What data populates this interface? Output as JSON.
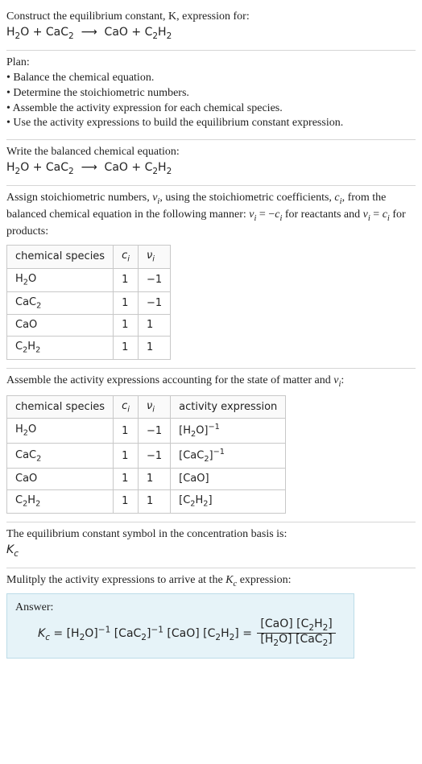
{
  "intro": {
    "line1": "Construct the equilibrium constant, K, expression for:",
    "equation_html": "H<span class='sub'>2</span>O + CaC<span class='sub'>2</span> &nbsp;⟶&nbsp; CaO + C<span class='sub'>2</span>H<span class='sub'>2</span>"
  },
  "plan": {
    "title": "Plan:",
    "b1": "• Balance the chemical equation.",
    "b2": "• Determine the stoichiometric numbers.",
    "b3": "• Assemble the activity expression for each chemical species.",
    "b4": "• Use the activity expressions to build the equilibrium constant expression."
  },
  "balance": {
    "title": "Write the balanced chemical equation:",
    "equation_html": "H<span class='sub'>2</span>O + CaC<span class='sub'>2</span> &nbsp;⟶&nbsp; CaO + C<span class='sub'>2</span>H<span class='sub'>2</span>"
  },
  "stoich": {
    "intro_html": "Assign stoichiometric numbers, <span class='it'>ν<span class='sub'>i</span></span>, using the stoichiometric coefficients, <span class='it'>c<span class='sub'>i</span></span>, from the balanced chemical equation in the following manner: <span class='it'>ν<span class='sub'>i</span></span> = −<span class='it'>c<span class='sub'>i</span></span> for reactants and <span class='it'>ν<span class='sub'>i</span></span> = <span class='it'>c<span class='sub'>i</span></span> for products:",
    "headers": {
      "h1": "chemical species",
      "h2_html": "<span class='it'>c<span class='sub'>i</span></span>",
      "h3_html": "<span class='it'>ν<span class='sub'>i</span></span>"
    },
    "rows": [
      {
        "sp_html": "H<span class='sub'>2</span>O",
        "c": "1",
        "v": "−1"
      },
      {
        "sp_html": "CaC<span class='sub'>2</span>",
        "c": "1",
        "v": "−1"
      },
      {
        "sp_html": "CaO",
        "c": "1",
        "v": "1"
      },
      {
        "sp_html": "C<span class='sub'>2</span>H<span class='sub'>2</span>",
        "c": "1",
        "v": "1"
      }
    ]
  },
  "activity": {
    "intro_html": "Assemble the activity expressions accounting for the state of matter and <span class='it'>ν<span class='sub'>i</span></span>:",
    "headers": {
      "h1": "chemical species",
      "h2_html": "<span class='it'>c<span class='sub'>i</span></span>",
      "h3_html": "<span class='it'>ν<span class='sub'>i</span></span>",
      "h4": "activity expression"
    },
    "rows": [
      {
        "sp_html": "H<span class='sub'>2</span>O",
        "c": "1",
        "v": "−1",
        "act_html": "[H<span class='sub'>2</span>O]<span class='sup'>−1</span>"
      },
      {
        "sp_html": "CaC<span class='sub'>2</span>",
        "c": "1",
        "v": "−1",
        "act_html": "[CaC<span class='sub'>2</span>]<span class='sup'>−1</span>"
      },
      {
        "sp_html": "CaO",
        "c": "1",
        "v": "1",
        "act_html": "[CaO]"
      },
      {
        "sp_html": "C<span class='sub'>2</span>H<span class='sub'>2</span>",
        "c": "1",
        "v": "1",
        "act_html": "[C<span class='sub'>2</span>H<span class='sub'>2</span>]"
      }
    ]
  },
  "kc_symbol": {
    "line1": "The equilibrium constant symbol in the concentration basis is:",
    "symbol_html": "<span class='kc'>K<span class='sub'>c</span></span>"
  },
  "final": {
    "intro_html": "Mulitply the activity expressions to arrive at the <span class='kc'>K<span class='sub'>c</span></span> expression:",
    "answer_label": "Answer:",
    "expr_left_html": "<span class='kc'>K<span class='sub'>c</span></span> = [H<span class='sub'>2</span>O]<span class='sup'>−1</span> [CaC<span class='sub'>2</span>]<span class='sup'>−1</span> [CaO] [C<span class='sub'>2</span>H<span class='sub'>2</span>] = ",
    "frac_num_html": "[CaO] [C<span class='sub'>2</span>H<span class='sub'>2</span>]",
    "frac_den_html": "[H<span class='sub'>2</span>O] [CaC<span class='sub'>2</span>]"
  }
}
